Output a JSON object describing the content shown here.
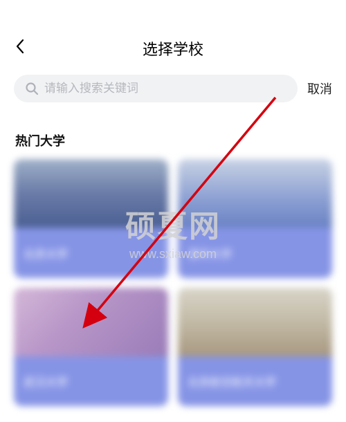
{
  "header": {
    "title": "选择学校"
  },
  "search": {
    "placeholder": "请输入搜索关键词",
    "cancel_label": "取消"
  },
  "section": {
    "title": "热门大学"
  },
  "watermark": {
    "main": "硕夏网",
    "sub": "www.sxiaw.com"
  },
  "cards": [
    {
      "label": "北京大学"
    },
    {
      "label": "清华大学"
    },
    {
      "label": "武汉大学"
    },
    {
      "label": "北京航空航天大学"
    }
  ]
}
